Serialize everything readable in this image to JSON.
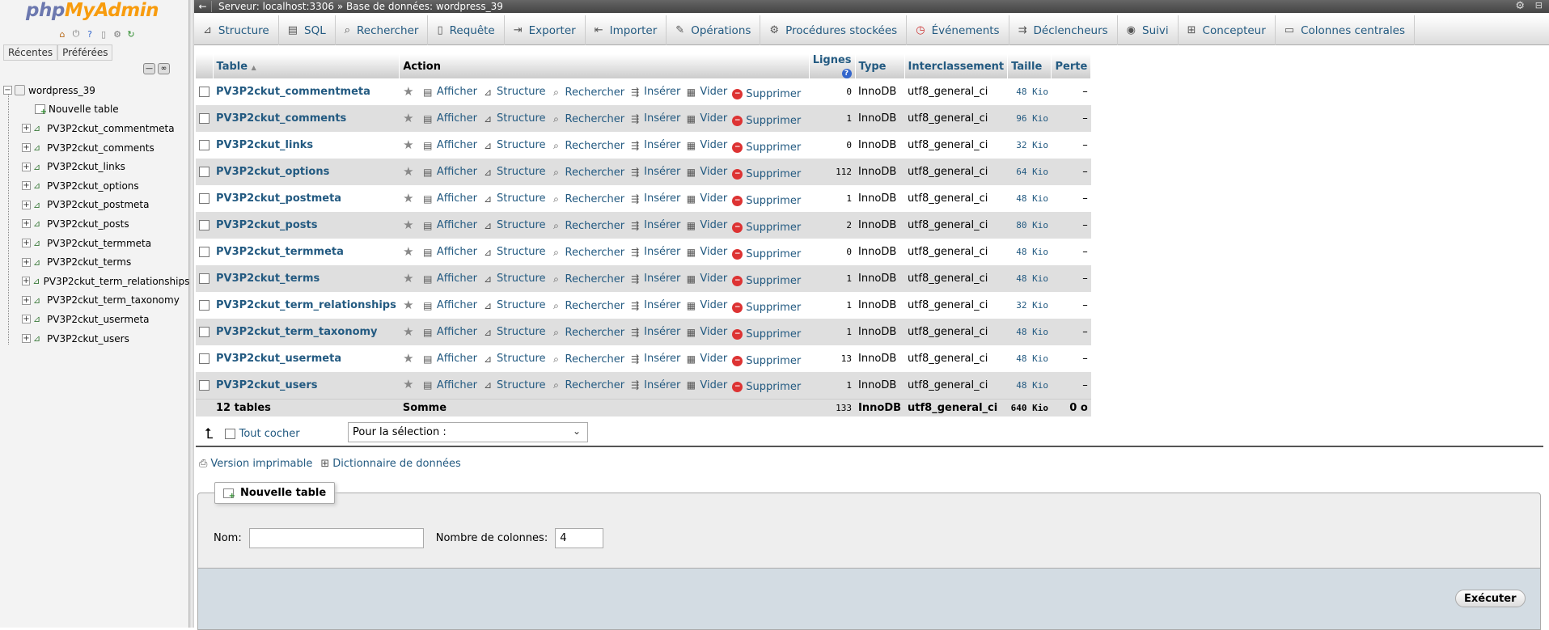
{
  "nav": {
    "logo_php": "php",
    "logo_myadmin": "MyAdmin",
    "tabs": [
      "Récentes",
      "Préférées"
    ],
    "database": "wordpress_39",
    "new_table": "Nouvelle table",
    "tables": [
      "PV3P2ckut_commentmeta",
      "PV3P2ckut_comments",
      "PV3P2ckut_links",
      "PV3P2ckut_options",
      "PV3P2ckut_postmeta",
      "PV3P2ckut_posts",
      "PV3P2ckut_termmeta",
      "PV3P2ckut_terms",
      "PV3P2ckut_term_relationships",
      "PV3P2ckut_term_taxonomy",
      "PV3P2ckut_usermeta",
      "PV3P2ckut_users"
    ]
  },
  "topbar": {
    "back": "←",
    "crumb": "Serveur: localhost:3306 » Base de données: wordpress_39"
  },
  "menu": [
    {
      "label": "Structure",
      "icon": "structure-icon"
    },
    {
      "label": "SQL",
      "icon": "sql-icon"
    },
    {
      "label": "Rechercher",
      "icon": "search-icon"
    },
    {
      "label": "Requête",
      "icon": "query-icon"
    },
    {
      "label": "Exporter",
      "icon": "export-icon"
    },
    {
      "label": "Importer",
      "icon": "import-icon"
    },
    {
      "label": "Opérations",
      "icon": "wrench-icon"
    },
    {
      "label": "Procédures stockées",
      "icon": "routines-icon"
    },
    {
      "label": "Événements",
      "icon": "clock-icon"
    },
    {
      "label": "Déclencheurs",
      "icon": "triggers-icon"
    },
    {
      "label": "Suivi",
      "icon": "eye-icon"
    },
    {
      "label": "Concepteur",
      "icon": "designer-icon"
    },
    {
      "label": "Colonnes centrales",
      "icon": "central-columns-icon"
    }
  ],
  "table": {
    "headers": {
      "table": "Table",
      "action": "Action",
      "rows": "Lignes",
      "type": "Type",
      "collation": "Interclassement",
      "size": "Taille",
      "overhead": "Perte"
    },
    "actions": [
      "Afficher",
      "Structure",
      "Rechercher",
      "Insérer",
      "Vider",
      "Supprimer"
    ],
    "rows": [
      {
        "name": "PV3P2ckut_commentmeta",
        "rows": "0",
        "type": "InnoDB",
        "collation": "utf8_general_ci",
        "size": "48 Kio",
        "overhead": "–"
      },
      {
        "name": "PV3P2ckut_comments",
        "rows": "1",
        "type": "InnoDB",
        "collation": "utf8_general_ci",
        "size": "96 Kio",
        "overhead": "–"
      },
      {
        "name": "PV3P2ckut_links",
        "rows": "0",
        "type": "InnoDB",
        "collation": "utf8_general_ci",
        "size": "32 Kio",
        "overhead": "–"
      },
      {
        "name": "PV3P2ckut_options",
        "rows": "112",
        "type": "InnoDB",
        "collation": "utf8_general_ci",
        "size": "64 Kio",
        "overhead": "–"
      },
      {
        "name": "PV3P2ckut_postmeta",
        "rows": "1",
        "type": "InnoDB",
        "collation": "utf8_general_ci",
        "size": "48 Kio",
        "overhead": "–"
      },
      {
        "name": "PV3P2ckut_posts",
        "rows": "2",
        "type": "InnoDB",
        "collation": "utf8_general_ci",
        "size": "80 Kio",
        "overhead": "–"
      },
      {
        "name": "PV3P2ckut_termmeta",
        "rows": "0",
        "type": "InnoDB",
        "collation": "utf8_general_ci",
        "size": "48 Kio",
        "overhead": "–"
      },
      {
        "name": "PV3P2ckut_terms",
        "rows": "1",
        "type": "InnoDB",
        "collation": "utf8_general_ci",
        "size": "48 Kio",
        "overhead": "–"
      },
      {
        "name": "PV3P2ckut_term_relationships",
        "rows": "1",
        "type": "InnoDB",
        "collation": "utf8_general_ci",
        "size": "32 Kio",
        "overhead": "–"
      },
      {
        "name": "PV3P2ckut_term_taxonomy",
        "rows": "1",
        "type": "InnoDB",
        "collation": "utf8_general_ci",
        "size": "48 Kio",
        "overhead": "–"
      },
      {
        "name": "PV3P2ckut_usermeta",
        "rows": "13",
        "type": "InnoDB",
        "collation": "utf8_general_ci",
        "size": "48 Kio",
        "overhead": "–"
      },
      {
        "name": "PV3P2ckut_users",
        "rows": "1",
        "type": "InnoDB",
        "collation": "utf8_general_ci",
        "size": "48 Kio",
        "overhead": "–"
      }
    ],
    "total": {
      "label": "12 tables",
      "sum": "Somme",
      "rows": "133",
      "type": "InnoDB",
      "collation": "utf8_general_ci",
      "size": "640 Kio",
      "overhead": "0 o"
    }
  },
  "bulk": {
    "check_all": "Tout cocher",
    "with_selected": "Pour la sélection :"
  },
  "links": {
    "print": "Version imprimable",
    "dictionary": "Dictionnaire de données"
  },
  "create": {
    "legend": "Nouvelle table",
    "name_label": "Nom:",
    "name_value": "",
    "cols_label": "Nombre de colonnes:",
    "cols_value": "4",
    "submit": "Exécuter"
  },
  "colors": {
    "link": "#235a81",
    "logo_php": "#6c78af",
    "logo_myadmin": "#f89c0e"
  }
}
